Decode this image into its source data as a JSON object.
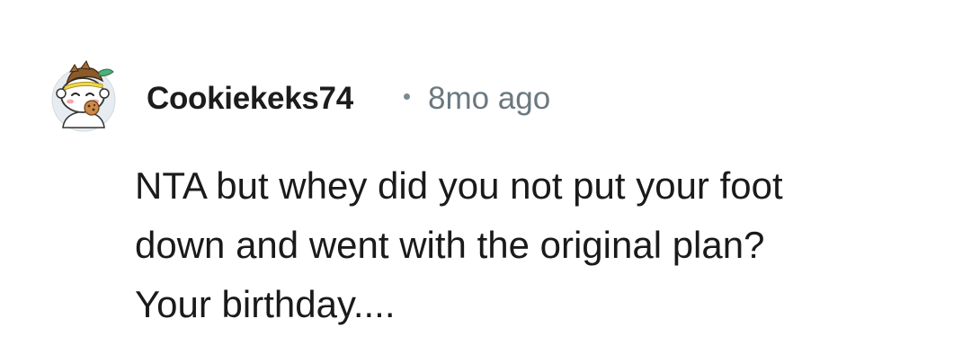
{
  "comment": {
    "author": "Cookiekeks74",
    "separator": "•",
    "timestamp": "8mo ago",
    "avatar_icon": "snoo-avatar-icon",
    "body": "NTA but whey did you not put your foot\ndown and went with the original plan?\nYour birthday...."
  },
  "colors": {
    "author": "#1c1c1c",
    "meta": "#6b7880",
    "body": "#1a1a1a",
    "background": "#ffffff"
  }
}
